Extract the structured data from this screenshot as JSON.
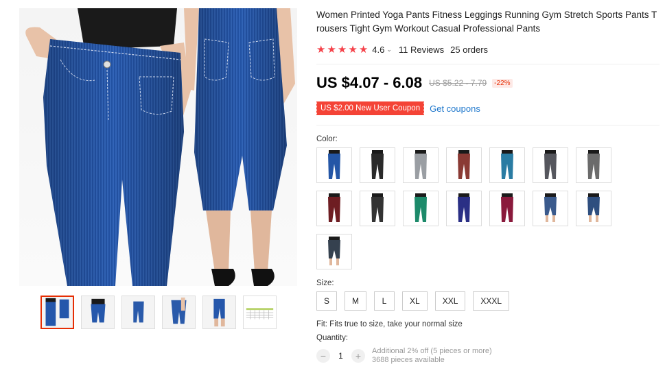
{
  "product": {
    "title": "Women Printed Yoga Pants Fitness Leggings Running Gym Stretch Sports Pants Trousers Tight Gym Workout Casual Professional Pants",
    "rating": "4.6",
    "reviews": "11 Reviews",
    "orders": "25 orders",
    "stars": 5
  },
  "price": {
    "current": "US $4.07 - 6.08",
    "original": "US $5.22 - 7.79",
    "discount": "-22%"
  },
  "coupon": {
    "label": "US $2.00 New User Coupon",
    "link": "Get coupons"
  },
  "color": {
    "label": "Color:",
    "swatches": [
      {
        "name": "blue-denim",
        "color": "#2456a6"
      },
      {
        "name": "black",
        "color": "#2a2a2a"
      },
      {
        "name": "gray",
        "color": "#9a9ea3"
      },
      {
        "name": "brown-red",
        "color": "#8a3a34"
      },
      {
        "name": "teal-blue",
        "color": "#2a7ca3"
      },
      {
        "name": "dark-gray",
        "color": "#55565d"
      },
      {
        "name": "charcoal",
        "color": "#6b6b6b"
      },
      {
        "name": "wine-red",
        "color": "#6e1d22"
      },
      {
        "name": "black-2",
        "color": "#333333"
      },
      {
        "name": "green",
        "color": "#1c8a6a"
      },
      {
        "name": "navy",
        "color": "#2a2f85"
      },
      {
        "name": "burgundy",
        "color": "#8a1a3c"
      },
      {
        "name": "denim-capri",
        "color": "#3a5a8c"
      },
      {
        "name": "denim-capri-2",
        "color": "#2f4f7f"
      },
      {
        "name": "dark-denim",
        "color": "#35414f"
      }
    ]
  },
  "size": {
    "label": "Size:",
    "options": [
      "S",
      "M",
      "L",
      "XL",
      "XXL",
      "XXXL"
    ],
    "fit": "Fit: Fits true to size, take your normal size"
  },
  "quantity": {
    "label": "Quantity:",
    "value": "1",
    "minus": "−",
    "plus": "+",
    "note_discount": "Additional 2% off (5 pieces or more)",
    "note_available": "3688 pieces available"
  },
  "gallery": {
    "thumbs": [
      "main",
      "front",
      "side",
      "back",
      "pose",
      "size-chart"
    ]
  },
  "colors": {
    "accent": "#e62e04",
    "star": "#f5424a",
    "link": "#1e77cc",
    "denim": "#2456a6"
  }
}
